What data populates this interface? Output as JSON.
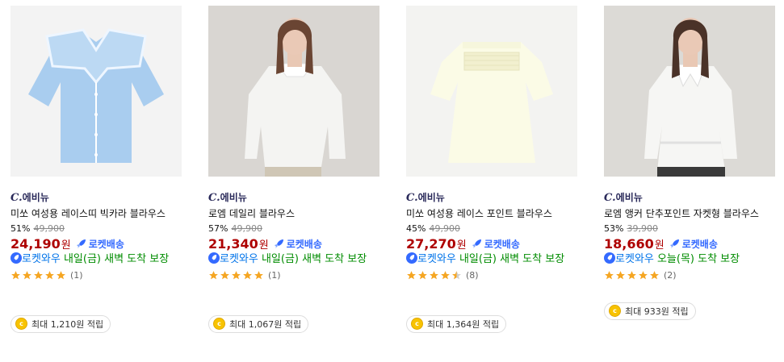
{
  "products": [
    {
      "brand": "C.에비뉴",
      "name": "미쏘 여성용 레이스띠 빅카라 블라우스",
      "discount": "51%",
      "original_price": "49,900",
      "sale_price": "24,190",
      "currency": "원",
      "rocket_label": "로켓배송",
      "wow_label": "로켓와우",
      "delivery_text": " 내일(금) 새벽 도착 보장",
      "rating": 5,
      "review_count": "(1)",
      "cashback": "최대 1,210원 적립",
      "image": "blue-gingham-blouse"
    },
    {
      "brand": "C.에비뉴",
      "name": "로엠 데일리 블라우스",
      "discount": "57%",
      "original_price": "49,900",
      "sale_price": "21,340",
      "currency": "원",
      "rocket_label": "로켓배송",
      "wow_label": "로켓와우",
      "delivery_text": " 내일(금) 새벽 도착 보장",
      "rating": 5,
      "review_count": "(1)",
      "cashback": "최대 1,067원 적립",
      "image": "model-white-blouse"
    },
    {
      "brand": "C.에비뉴",
      "name": "미쏘 여성용 레이스 포인트 블라우스",
      "discount": "45%",
      "original_price": "49,900",
      "sale_price": "27,270",
      "currency": "원",
      "rocket_label": "로켓배송",
      "wow_label": "로켓와우",
      "delivery_text": " 내일(금) 새벽 도착 보장",
      "rating": 4.5,
      "review_count": "(8)",
      "cashback": "최대 1,364원 적립",
      "image": "cream-lace-blouse"
    },
    {
      "brand": "C.에비뉴",
      "name": "로엠 앵커 단추포인트 자켓형 블라우스",
      "discount": "53%",
      "original_price": "39,900",
      "sale_price": "18,660",
      "currency": "원",
      "rocket_label": "로켓배송",
      "wow_label": "로켓와우",
      "delivery_text": " 오늘(목) 도착 보장",
      "rating": 5,
      "review_count": "(2)",
      "cashback": "최대 933원 적립",
      "image": "model-jacket-blouse"
    }
  ],
  "colors": {
    "price": "#ae0000",
    "rocket": "#346aff",
    "delivery": "#008c00",
    "star": "#f5a623"
  }
}
